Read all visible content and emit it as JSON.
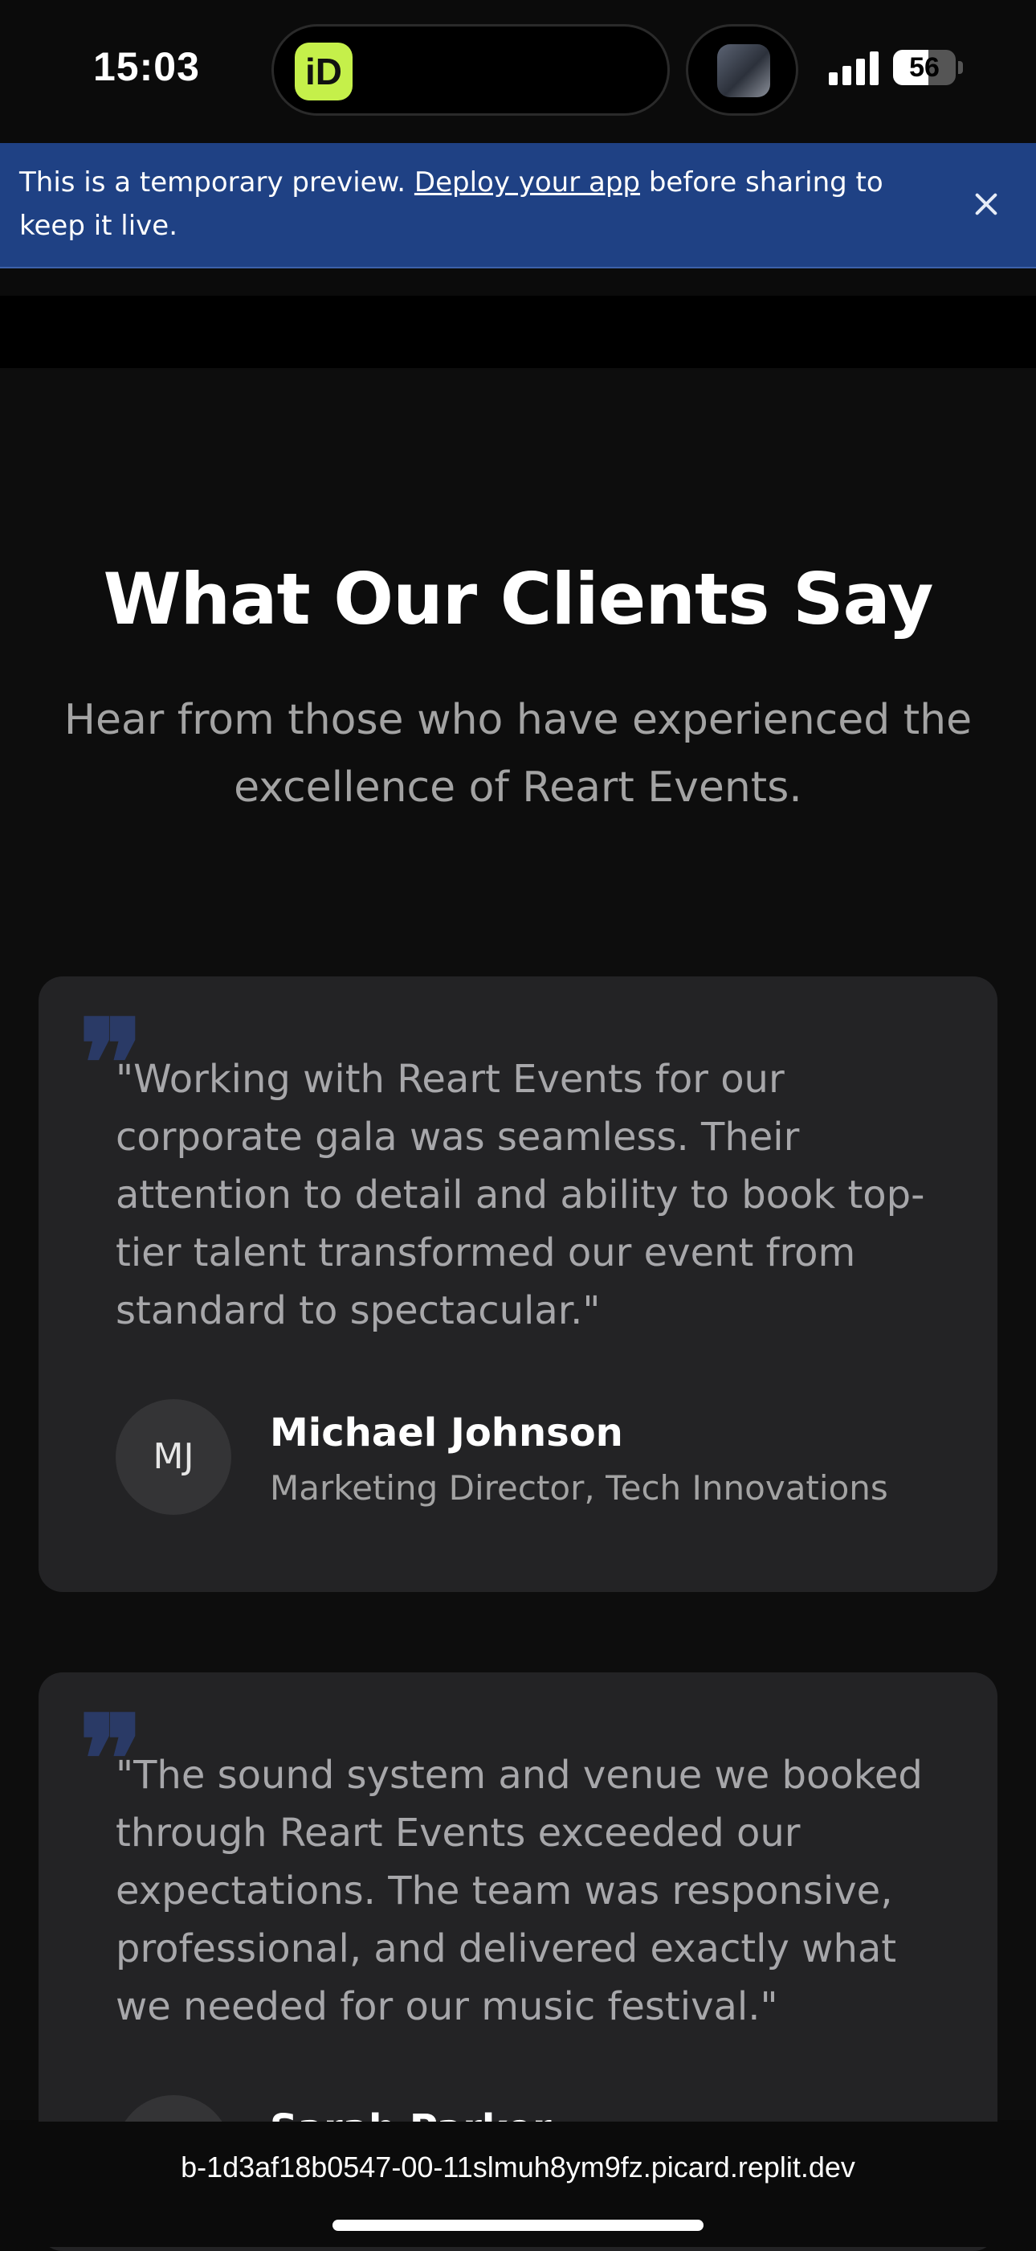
{
  "status_bar": {
    "time": "15:03",
    "app_icon_letters": "iD",
    "battery_percent": "56",
    "signal_bars": 4
  },
  "banner": {
    "text_before": "This is a temporary preview. ",
    "link_text": "Deploy your app",
    "text_after": " before sharing to keep it live.",
    "background": "#1f4184"
  },
  "testimonials_section": {
    "title": "What Our Clients Say",
    "subtitle": "Hear from those who have experienced the excellence of Reart Events.",
    "testimonials": [
      {
        "quote": "\"Working with Reart Events for our corporate gala was seamless. Their attention to detail and ability to book top-tier talent transformed our event from standard to spectacular.\"",
        "initials": "MJ",
        "name": "Michael Johnson",
        "role": "Marketing Director, Tech Innovations"
      },
      {
        "quote": "\"The sound system and venue we booked through Reart Events exceeded our expectations. The team was responsive, professional, and delivered exactly what we needed for our music festival.\"",
        "initials": "",
        "name": "Sarah Parker",
        "role": ""
      }
    ]
  },
  "browser": {
    "url": "b-1d3af18b0547-00-11slmuh8ym9fz.picard.replit.dev"
  },
  "colors": {
    "accent_quote": "#2a3a66",
    "card_background": "#232325",
    "page_background": "#0d0d0d"
  },
  "icons": [
    "app-icon",
    "signal-icon",
    "battery-icon",
    "close-icon",
    "quote-icon"
  ]
}
